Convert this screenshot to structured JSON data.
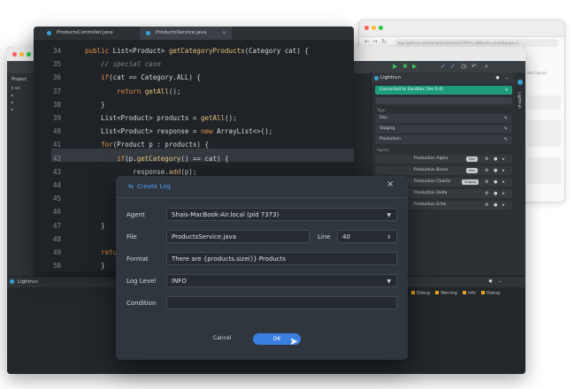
{
  "browser": {
    "url": "app.lightrun.com/company/products?filter=all&sort=name&page=1",
    "side_text": "Not Signed"
  },
  "ide": {
    "project_label": "Project",
    "tree": [
      "▾ src",
      "  ▸ ",
      "  ▸ ",
      "  ▸ "
    ]
  },
  "editor": {
    "tabs": [
      "ProductsController.java",
      "ProductsService.java"
    ],
    "line_numbers": [
      "34",
      "35",
      "36",
      "37",
      "38",
      "39",
      "40",
      "41",
      "42",
      "43",
      "44",
      "45",
      "46",
      "47",
      "48",
      "49",
      "50"
    ],
    "lines": [
      "public List<Product> getCategoryProducts(Category cat) {",
      "    // special case",
      "    if(cat == Category.ALL) {",
      "        return getAll();",
      "    }",
      "    List<Product> products = getAll();",
      "    List<Product> response = new ArrayList<>();",
      "    for(Product p : products) {",
      "        if(p.getCategory() == cat) {",
      "            response.add(p);",
      "        } el",
      "        thro",
      "        }",
      "    }",
      "",
      "    return r",
      "    }"
    ]
  },
  "lightrun_panel": {
    "title": "Lightrun",
    "connected": "Connected to Sandbox (Ver 6.0)",
    "section_tags": "Tags",
    "tags": [
      "Dev",
      "Staging",
      "Production"
    ],
    "section_agents": "Agents",
    "agents": [
      {
        "name": "Production Alpha",
        "tag": "Dev"
      },
      {
        "name": "Production Bravo",
        "tag": "Dev"
      },
      {
        "name": "Production Charlie",
        "tag": "Staging"
      },
      {
        "name": "Production Delta",
        "tag": ""
      },
      {
        "name": "Production Echo",
        "tag": ""
      }
    ],
    "vertical_tab": "Lightrun"
  },
  "console": {
    "title": "Lightrun",
    "filters": [
      "Debug",
      "Warning",
      "Info",
      "Debug"
    ]
  },
  "dialog": {
    "title": "Create Log",
    "labels": {
      "agent": "Agent",
      "file": "File",
      "line": "Line",
      "format": "Format",
      "log_level": "Log Level",
      "condition": "Condition"
    },
    "values": {
      "agent": "Shais-MacBook-Air.local (pid 7373)",
      "file": "ProductsService.java",
      "line": "40",
      "format": "There are {products.size()} Products",
      "log_level": "INFO",
      "condition": ""
    },
    "cancel_label": "Cancel",
    "ok_label": "OK"
  },
  "colors": {
    "accent": "#3a7fe0",
    "connected": "#1e9b7a",
    "keyword": "#e0913f"
  }
}
